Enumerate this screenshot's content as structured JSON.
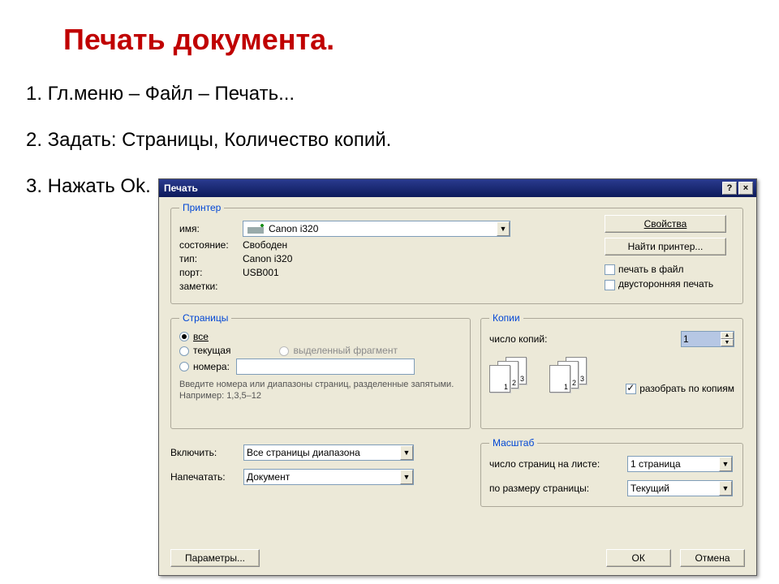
{
  "slide": {
    "title": "Печать документа.",
    "item1": "1. Гл.меню – Файл – Печать...",
    "item2": "2. Задать: Страницы, Количество копий.",
    "item3": "3. Нажать Ok."
  },
  "dialog": {
    "title": "Печать",
    "help_char": "?",
    "close_char": "×",
    "printer_group": "Принтер",
    "labels": {
      "name": "имя:",
      "status": "состояние:",
      "type": "тип:",
      "port": "порт:",
      "notes": "заметки:"
    },
    "printer": {
      "name": "Canon i320",
      "status": "Свободен",
      "type": "Canon i320",
      "port": "USB001",
      "notes": ""
    },
    "buttons": {
      "properties": "Свойства",
      "find_printer": "Найти принтер...",
      "options": "Параметры...",
      "ok": "ОК",
      "cancel": "Отмена"
    },
    "checkboxes": {
      "print_to_file": "печать в файл",
      "duplex": "двусторонняя печать",
      "collate": "разобрать по копиям"
    },
    "pages_group": "Страницы",
    "pages": {
      "all": "все",
      "current": "текущая",
      "selection": "выделенный фрагмент",
      "numbers": "номера:",
      "hint": "Введите номера или диапазоны страниц, разделенные запятыми. Например: 1,3,5–12"
    },
    "copies_group": "Копии",
    "copies_label": "число копий:",
    "copies_value": "1",
    "include_label": "Включить:",
    "include_value": "Все страницы диапазона",
    "print_what_label": "Напечатать:",
    "print_what_value": "Документ",
    "scale_group": "Масштаб",
    "pages_per_sheet_label": "число страниц на листе:",
    "pages_per_sheet_value": "1 страница",
    "fit_to_label": "по размеру страницы:",
    "fit_to_value": "Текущий",
    "dd_glyph": "▼",
    "up_glyph": "▲"
  }
}
